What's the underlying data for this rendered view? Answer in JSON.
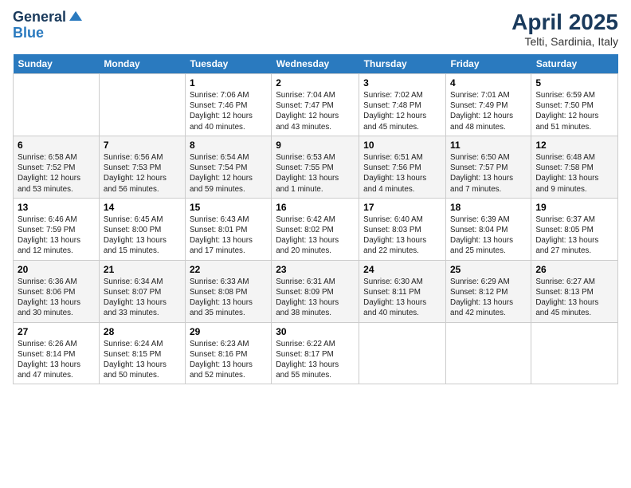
{
  "header": {
    "logo_line1": "General",
    "logo_line2": "Blue",
    "main_title": "April 2025",
    "subtitle": "Telti, Sardinia, Italy"
  },
  "columns": [
    "Sunday",
    "Monday",
    "Tuesday",
    "Wednesday",
    "Thursday",
    "Friday",
    "Saturday"
  ],
  "weeks": [
    [
      {
        "num": "",
        "info": ""
      },
      {
        "num": "",
        "info": ""
      },
      {
        "num": "1",
        "info": "Sunrise: 7:06 AM\nSunset: 7:46 PM\nDaylight: 12 hours\nand 40 minutes."
      },
      {
        "num": "2",
        "info": "Sunrise: 7:04 AM\nSunset: 7:47 PM\nDaylight: 12 hours\nand 43 minutes."
      },
      {
        "num": "3",
        "info": "Sunrise: 7:02 AM\nSunset: 7:48 PM\nDaylight: 12 hours\nand 45 minutes."
      },
      {
        "num": "4",
        "info": "Sunrise: 7:01 AM\nSunset: 7:49 PM\nDaylight: 12 hours\nand 48 minutes."
      },
      {
        "num": "5",
        "info": "Sunrise: 6:59 AM\nSunset: 7:50 PM\nDaylight: 12 hours\nand 51 minutes."
      }
    ],
    [
      {
        "num": "6",
        "info": "Sunrise: 6:58 AM\nSunset: 7:52 PM\nDaylight: 12 hours\nand 53 minutes."
      },
      {
        "num": "7",
        "info": "Sunrise: 6:56 AM\nSunset: 7:53 PM\nDaylight: 12 hours\nand 56 minutes."
      },
      {
        "num": "8",
        "info": "Sunrise: 6:54 AM\nSunset: 7:54 PM\nDaylight: 12 hours\nand 59 minutes."
      },
      {
        "num": "9",
        "info": "Sunrise: 6:53 AM\nSunset: 7:55 PM\nDaylight: 13 hours\nand 1 minute."
      },
      {
        "num": "10",
        "info": "Sunrise: 6:51 AM\nSunset: 7:56 PM\nDaylight: 13 hours\nand 4 minutes."
      },
      {
        "num": "11",
        "info": "Sunrise: 6:50 AM\nSunset: 7:57 PM\nDaylight: 13 hours\nand 7 minutes."
      },
      {
        "num": "12",
        "info": "Sunrise: 6:48 AM\nSunset: 7:58 PM\nDaylight: 13 hours\nand 9 minutes."
      }
    ],
    [
      {
        "num": "13",
        "info": "Sunrise: 6:46 AM\nSunset: 7:59 PM\nDaylight: 13 hours\nand 12 minutes."
      },
      {
        "num": "14",
        "info": "Sunrise: 6:45 AM\nSunset: 8:00 PM\nDaylight: 13 hours\nand 15 minutes."
      },
      {
        "num": "15",
        "info": "Sunrise: 6:43 AM\nSunset: 8:01 PM\nDaylight: 13 hours\nand 17 minutes."
      },
      {
        "num": "16",
        "info": "Sunrise: 6:42 AM\nSunset: 8:02 PM\nDaylight: 13 hours\nand 20 minutes."
      },
      {
        "num": "17",
        "info": "Sunrise: 6:40 AM\nSunset: 8:03 PM\nDaylight: 13 hours\nand 22 minutes."
      },
      {
        "num": "18",
        "info": "Sunrise: 6:39 AM\nSunset: 8:04 PM\nDaylight: 13 hours\nand 25 minutes."
      },
      {
        "num": "19",
        "info": "Sunrise: 6:37 AM\nSunset: 8:05 PM\nDaylight: 13 hours\nand 27 minutes."
      }
    ],
    [
      {
        "num": "20",
        "info": "Sunrise: 6:36 AM\nSunset: 8:06 PM\nDaylight: 13 hours\nand 30 minutes."
      },
      {
        "num": "21",
        "info": "Sunrise: 6:34 AM\nSunset: 8:07 PM\nDaylight: 13 hours\nand 33 minutes."
      },
      {
        "num": "22",
        "info": "Sunrise: 6:33 AM\nSunset: 8:08 PM\nDaylight: 13 hours\nand 35 minutes."
      },
      {
        "num": "23",
        "info": "Sunrise: 6:31 AM\nSunset: 8:09 PM\nDaylight: 13 hours\nand 38 minutes."
      },
      {
        "num": "24",
        "info": "Sunrise: 6:30 AM\nSunset: 8:11 PM\nDaylight: 13 hours\nand 40 minutes."
      },
      {
        "num": "25",
        "info": "Sunrise: 6:29 AM\nSunset: 8:12 PM\nDaylight: 13 hours\nand 42 minutes."
      },
      {
        "num": "26",
        "info": "Sunrise: 6:27 AM\nSunset: 8:13 PM\nDaylight: 13 hours\nand 45 minutes."
      }
    ],
    [
      {
        "num": "27",
        "info": "Sunrise: 6:26 AM\nSunset: 8:14 PM\nDaylight: 13 hours\nand 47 minutes."
      },
      {
        "num": "28",
        "info": "Sunrise: 6:24 AM\nSunset: 8:15 PM\nDaylight: 13 hours\nand 50 minutes."
      },
      {
        "num": "29",
        "info": "Sunrise: 6:23 AM\nSunset: 8:16 PM\nDaylight: 13 hours\nand 52 minutes."
      },
      {
        "num": "30",
        "info": "Sunrise: 6:22 AM\nSunset: 8:17 PM\nDaylight: 13 hours\nand 55 minutes."
      },
      {
        "num": "",
        "info": ""
      },
      {
        "num": "",
        "info": ""
      },
      {
        "num": "",
        "info": ""
      }
    ]
  ]
}
